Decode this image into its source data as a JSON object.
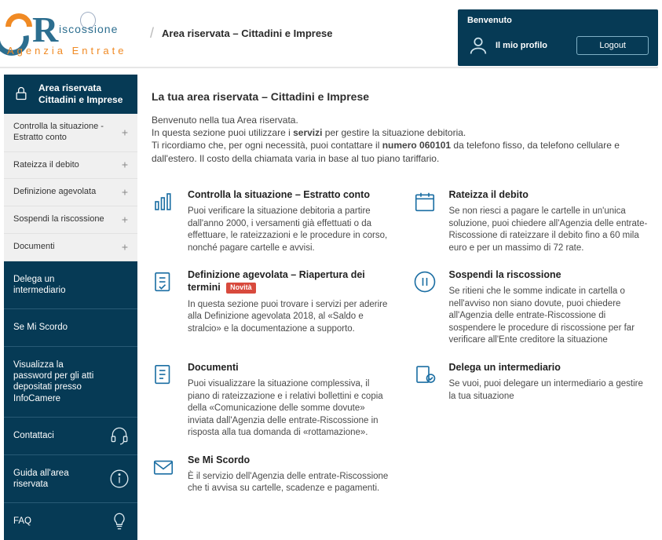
{
  "header": {
    "logo_top": "iscossione",
    "logo_bottom": "Agenzia Entrate",
    "crumb_sep": "/",
    "breadcrumb": "Area riservata – Cittadini e Imprese"
  },
  "user_panel": {
    "welcome": "Benvenuto",
    "profile": "Il mio profilo",
    "logout": "Logout"
  },
  "sidebar": {
    "title_line1": "Area riservata",
    "title_line2": "Cittadini e Imprese",
    "menu": [
      {
        "label": "Controlla la situazione - Estratto conto"
      },
      {
        "label": "Rateizza il debito"
      },
      {
        "label": "Definizione agevolata"
      },
      {
        "label": "Sospendi la riscossione"
      },
      {
        "label": "Documenti"
      }
    ],
    "links": [
      {
        "label": "Delega un intermediario"
      },
      {
        "label": "Se Mi Scordo"
      },
      {
        "label": "Visualizza la password per gli atti depositati presso InfoCamere"
      },
      {
        "label": "Contattaci",
        "icon": "headset"
      },
      {
        "label": "Guida all'area riservata",
        "icon": "info"
      },
      {
        "label": "FAQ",
        "icon": "bulb"
      }
    ],
    "plus": "+"
  },
  "content": {
    "title": "La tua area riservata – Cittadini e Imprese",
    "intro_line1": "Benvenuto nella tua Area riservata.",
    "intro_line2a": "In questa sezione puoi utilizzare i ",
    "intro_line2b": "servizi",
    "intro_line2c": " per gestire la situazione debitoria.",
    "intro_line3a": "Ti ricordiamo che, per ogni necessità, puoi contattare il ",
    "intro_line3b": "numero 060101",
    "intro_line3c": " da telefono fisso, da telefono cellulare e dall'estero. Il costo della chiamata varia in base al tuo piano tariffario."
  },
  "cards": {
    "c1": {
      "title": "Controlla la situazione – Estratto conto",
      "text": "Puoi verificare la situazione debitoria a partire dall'anno 2000, i versamenti già effettuati o da effettuare, le rateizzazioni e le procedure in corso, nonché pagare cartelle e avvisi."
    },
    "c2": {
      "title": "Rateizza il debito",
      "text": "Se non riesci a pagare le cartelle in un'unica soluzione, puoi chiedere all'Agenzia delle entrate-Riscossione di rateizzare il debito fino a 60 mila euro e per un massimo di 72 rate."
    },
    "c3": {
      "title": "Definizione agevolata – Riapertura dei termini",
      "badge": "Novità",
      "text": "In questa sezione puoi trovare i servizi per aderire alla Definizione agevolata 2018, al «Saldo e stralcio» e la documentazione a supporto."
    },
    "c4": {
      "title": "Sospendi la riscossione",
      "text": "Se ritieni che le somme indicate in cartella o nell'avviso non siano dovute, puoi chiedere all'Agenzia delle entrate-Riscossione di sospendere le procedure di riscossione per far verificare all'Ente creditore la situazione"
    },
    "c5": {
      "title": "Documenti",
      "text": "Puoi visualizzare la situazione complessiva, il piano di rateizzazione e i relativi bollettini e copia della «Comunicazione delle somme dovute» inviata dall'Agenzia delle entrate-Riscossione in risposta alla tua domanda di «rottamazione»."
    },
    "c6": {
      "title": "Delega un intermediario",
      "text": "Se vuoi, puoi delegare un intermediario a gestire la tua situazione"
    },
    "c7": {
      "title": "Se Mi Scordo",
      "text": "È il servizio dell'Agenzia delle entrate-Riscossione che ti avvisa su cartelle, scadenze e pagamenti."
    }
  }
}
